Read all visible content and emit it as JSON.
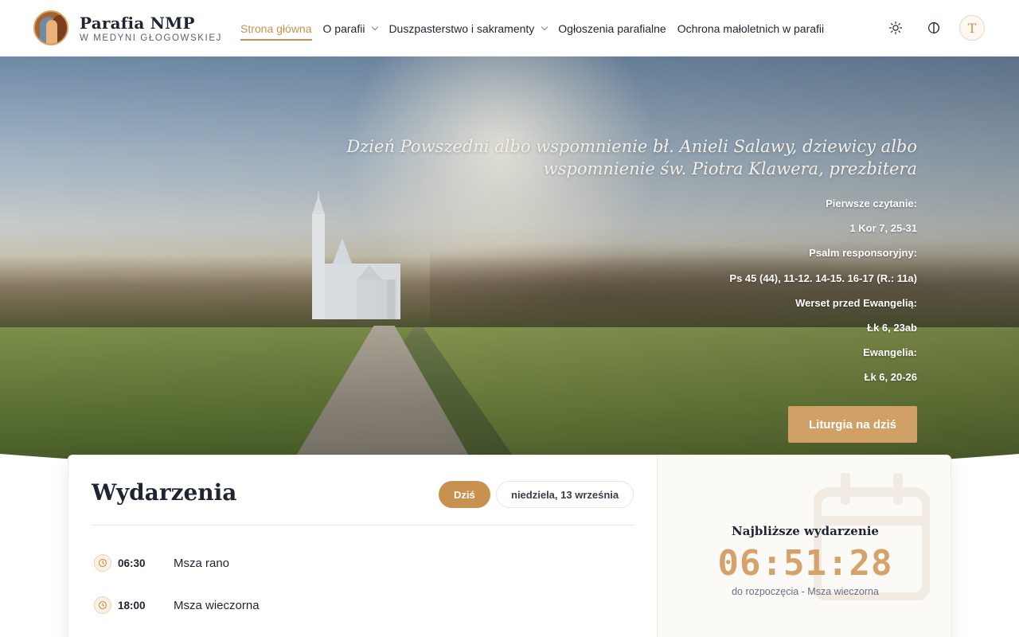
{
  "brand": {
    "title": "Parafia NMP",
    "subtitle": "W MEDYNI GŁOGOWSKIEJ"
  },
  "nav": {
    "items": [
      {
        "label": "Strona główna",
        "active": true
      },
      {
        "label": "O parafii",
        "dropdown": true
      },
      {
        "label": "Duszpasterstwo i sakramenty",
        "dropdown": true
      },
      {
        "label": "Ogłoszenia parafialne"
      },
      {
        "label": "Ochrona małoletnich w parafii"
      }
    ]
  },
  "header_actions": {
    "theme_icon": "sun-icon",
    "contrast_icon": "contrast-icon",
    "avatar_letter": "T"
  },
  "hero": {
    "feast": "Dzień Powszedni albo wspomnienie bł. Anieli Salawy, dziewicy albo wspomnienie św. Piotra Klawera, prezbitera",
    "readings": [
      "Pierwsze czytanie:",
      "1 Kor 7, 25-31",
      "Psalm responsoryjny:",
      "Ps 45 (44), 11-12. 14-15. 16-17 (R.: 11a)",
      "Werset przed Ewangelią:",
      "Łk 6, 23ab",
      "Ewangelia:",
      "Łk 6, 20-26"
    ],
    "button_label": "Liturgia na dziś"
  },
  "events": {
    "title": "Wydarzenia",
    "today_label": "Dziś",
    "date_label": "niedziela, 13 września",
    "items": [
      {
        "time": "06:30",
        "name": "Msza rano"
      },
      {
        "time": "18:00",
        "name": "Msza wieczorna"
      }
    ],
    "next": {
      "label": "Najbliższe wydarzenie",
      "countdown": "06:51:28",
      "caption": "do rozpoczęcia - Msza wieczorna"
    }
  },
  "colors": {
    "accent": "#c9914e",
    "button": "#d0a066",
    "countdown": "#d4a26a"
  }
}
